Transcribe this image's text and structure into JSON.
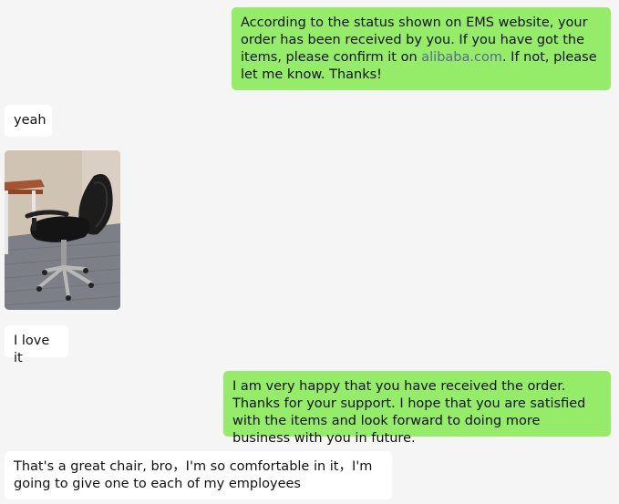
{
  "messages": {
    "m1": {
      "text_before": "According to the status shown on EMS website, your order has been received by you. If you have got the items, please confirm it on ",
      "link": "alibaba.com",
      "text_after": ". If not, please let me know. Thanks!"
    },
    "m2": {
      "text": "yeah"
    },
    "m3": {
      "image": "office-chair-photo"
    },
    "m4": {
      "text": "I love it"
    },
    "m5": {
      "text": "I am very happy that you have received the order. Thanks for your support. I hope that you are satisfied with the items and look forward to doing more business with you in future."
    },
    "m6": {
      "text": "That's a great chair, bro，I'm so comfortable in it，I'm going to give one to each of my employees"
    }
  },
  "colors": {
    "outgoing_bubble": "#95ec69",
    "incoming_bubble": "#ffffff",
    "background": "#f5f5f5",
    "link": "#576b95"
  }
}
